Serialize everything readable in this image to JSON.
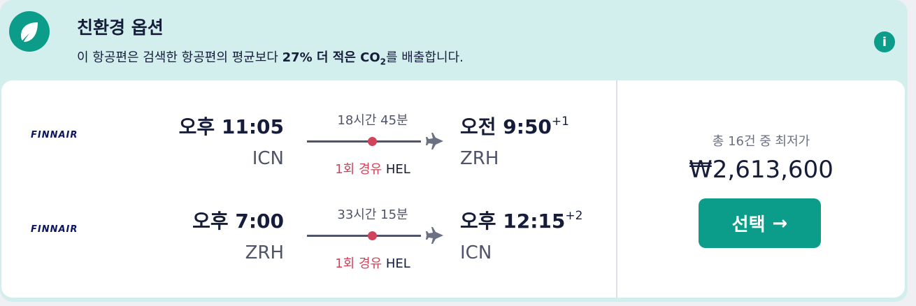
{
  "eco": {
    "title": "친환경 옵션",
    "desc_prefix": "이 항공편은 검색한 항공편의 평균보다 ",
    "desc_bold": "27% 더 적은 CO",
    "desc_sub": "2",
    "desc_suffix": "를 배출합니다."
  },
  "legs": [
    {
      "airline": "FINNAIR",
      "dep_time": "오후 11:05",
      "dep_code": "ICN",
      "duration": "18시간 45분",
      "stops_label": "1회 경유",
      "stop_airport": "HEL",
      "arr_time": "오전 9:50",
      "arr_offset": "+1",
      "arr_code": "ZRH"
    },
    {
      "airline": "FINNAIR",
      "dep_time": "오후 7:00",
      "dep_code": "ZRH",
      "duration": "33시간 15분",
      "stops_label": "1회 경유",
      "stop_airport": "HEL",
      "arr_time": "오후 12:15",
      "arr_offset": "+2",
      "arr_code": "ICN"
    }
  ],
  "price": {
    "label": "총 16건 중 최저가",
    "amount": "₩2,613,600",
    "select_label": "선택",
    "select_arrow": "→"
  },
  "colors": {
    "accent": "#0c9d8a",
    "eco_bg": "#d2efee",
    "stop_red": "#d1435b",
    "text_dark": "#161d3a"
  }
}
